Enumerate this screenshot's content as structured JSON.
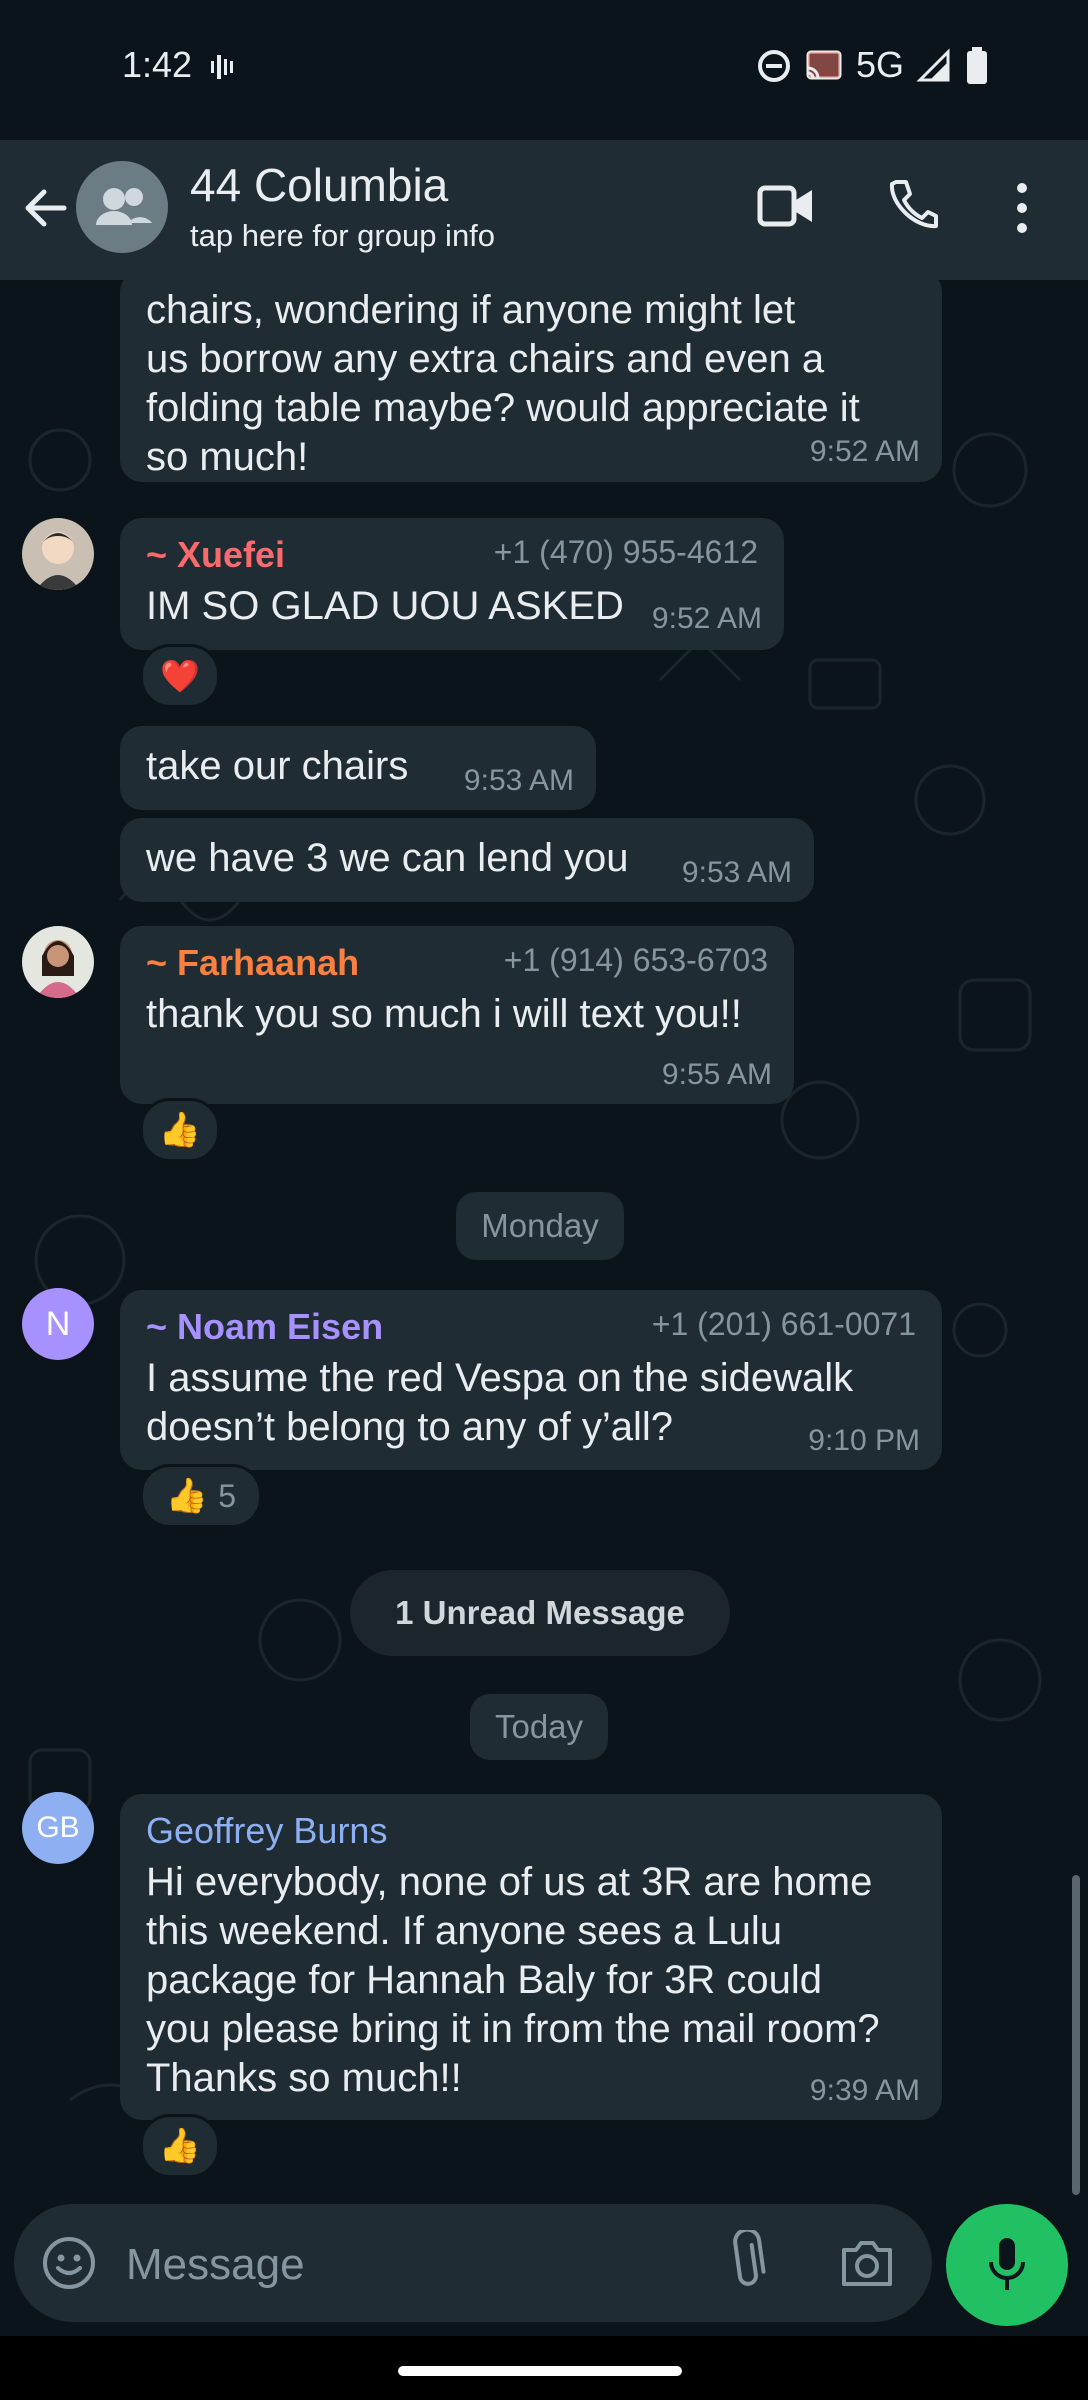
{
  "status_bar": {
    "time": "1:42",
    "network": "5G"
  },
  "header": {
    "title": "44 Columbia",
    "subtitle": "tap here for group info"
  },
  "messages": [
    {
      "text_lines": [
        "chairs, wondering if anyone might let",
        "us borrow any extra chairs and even a",
        "folding table maybe? would appreciate it",
        "so much!"
      ],
      "time": "9:52 AM"
    },
    {
      "sender": "~ Xuefei",
      "phone": "+1 (470) 955-4612",
      "text_lines": [
        "IM SO GLAD UOU ASKED"
      ],
      "time": "9:52 AM",
      "reaction": "❤️"
    },
    {
      "text_lines": [
        "take our chairs"
      ],
      "time": "9:53 AM"
    },
    {
      "text_lines": [
        "we have 3 we can lend you"
      ],
      "time": "9:53 AM"
    },
    {
      "sender": "~ Farhaanah",
      "phone": "+1 (914) 653-6703",
      "text_lines": [
        "thank you so much i will text you!!"
      ],
      "time": "9:55 AM",
      "reaction": "👍"
    },
    {
      "sender": "~ Noam Eisen",
      "avatar_letter": "N",
      "phone": "+1 (201) 661-0071",
      "text_lines": [
        "I assume the red Vespa on the sidewalk",
        "doesn’t belong to any of y’all?"
      ],
      "time": "9:10 PM",
      "reaction": "👍",
      "reaction_count": "5"
    },
    {
      "sender": "Geoffrey Burns",
      "avatar_letter": "GB",
      "text_lines": [
        "Hi everybody, none of us at 3R are home",
        "this weekend. If anyone sees a Lulu",
        "package for Hannah Baly for 3R could",
        "you please bring it in from the mail room?",
        "Thanks so much!!"
      ],
      "time": "9:39 AM",
      "reaction": "👍"
    }
  ],
  "dividers": {
    "monday": "Monday",
    "unread": "1 Unread Message",
    "today": "Today"
  },
  "composer": {
    "placeholder": "Message"
  },
  "colors": {
    "xuefei": "#fa6a6a",
    "farhaanah": "#f9803e",
    "noam": "#a791ff",
    "geoffrey": "#8eb0f3",
    "accent_green": "#21c063",
    "bubble": "#1f2c34",
    "background": "#0b141a"
  },
  "icons": [
    "back-arrow-icon",
    "group-avatar-icon",
    "video-call-icon",
    "phone-call-icon",
    "more-options-icon",
    "emoji-icon",
    "attach-icon",
    "camera-icon",
    "mic-icon"
  ]
}
